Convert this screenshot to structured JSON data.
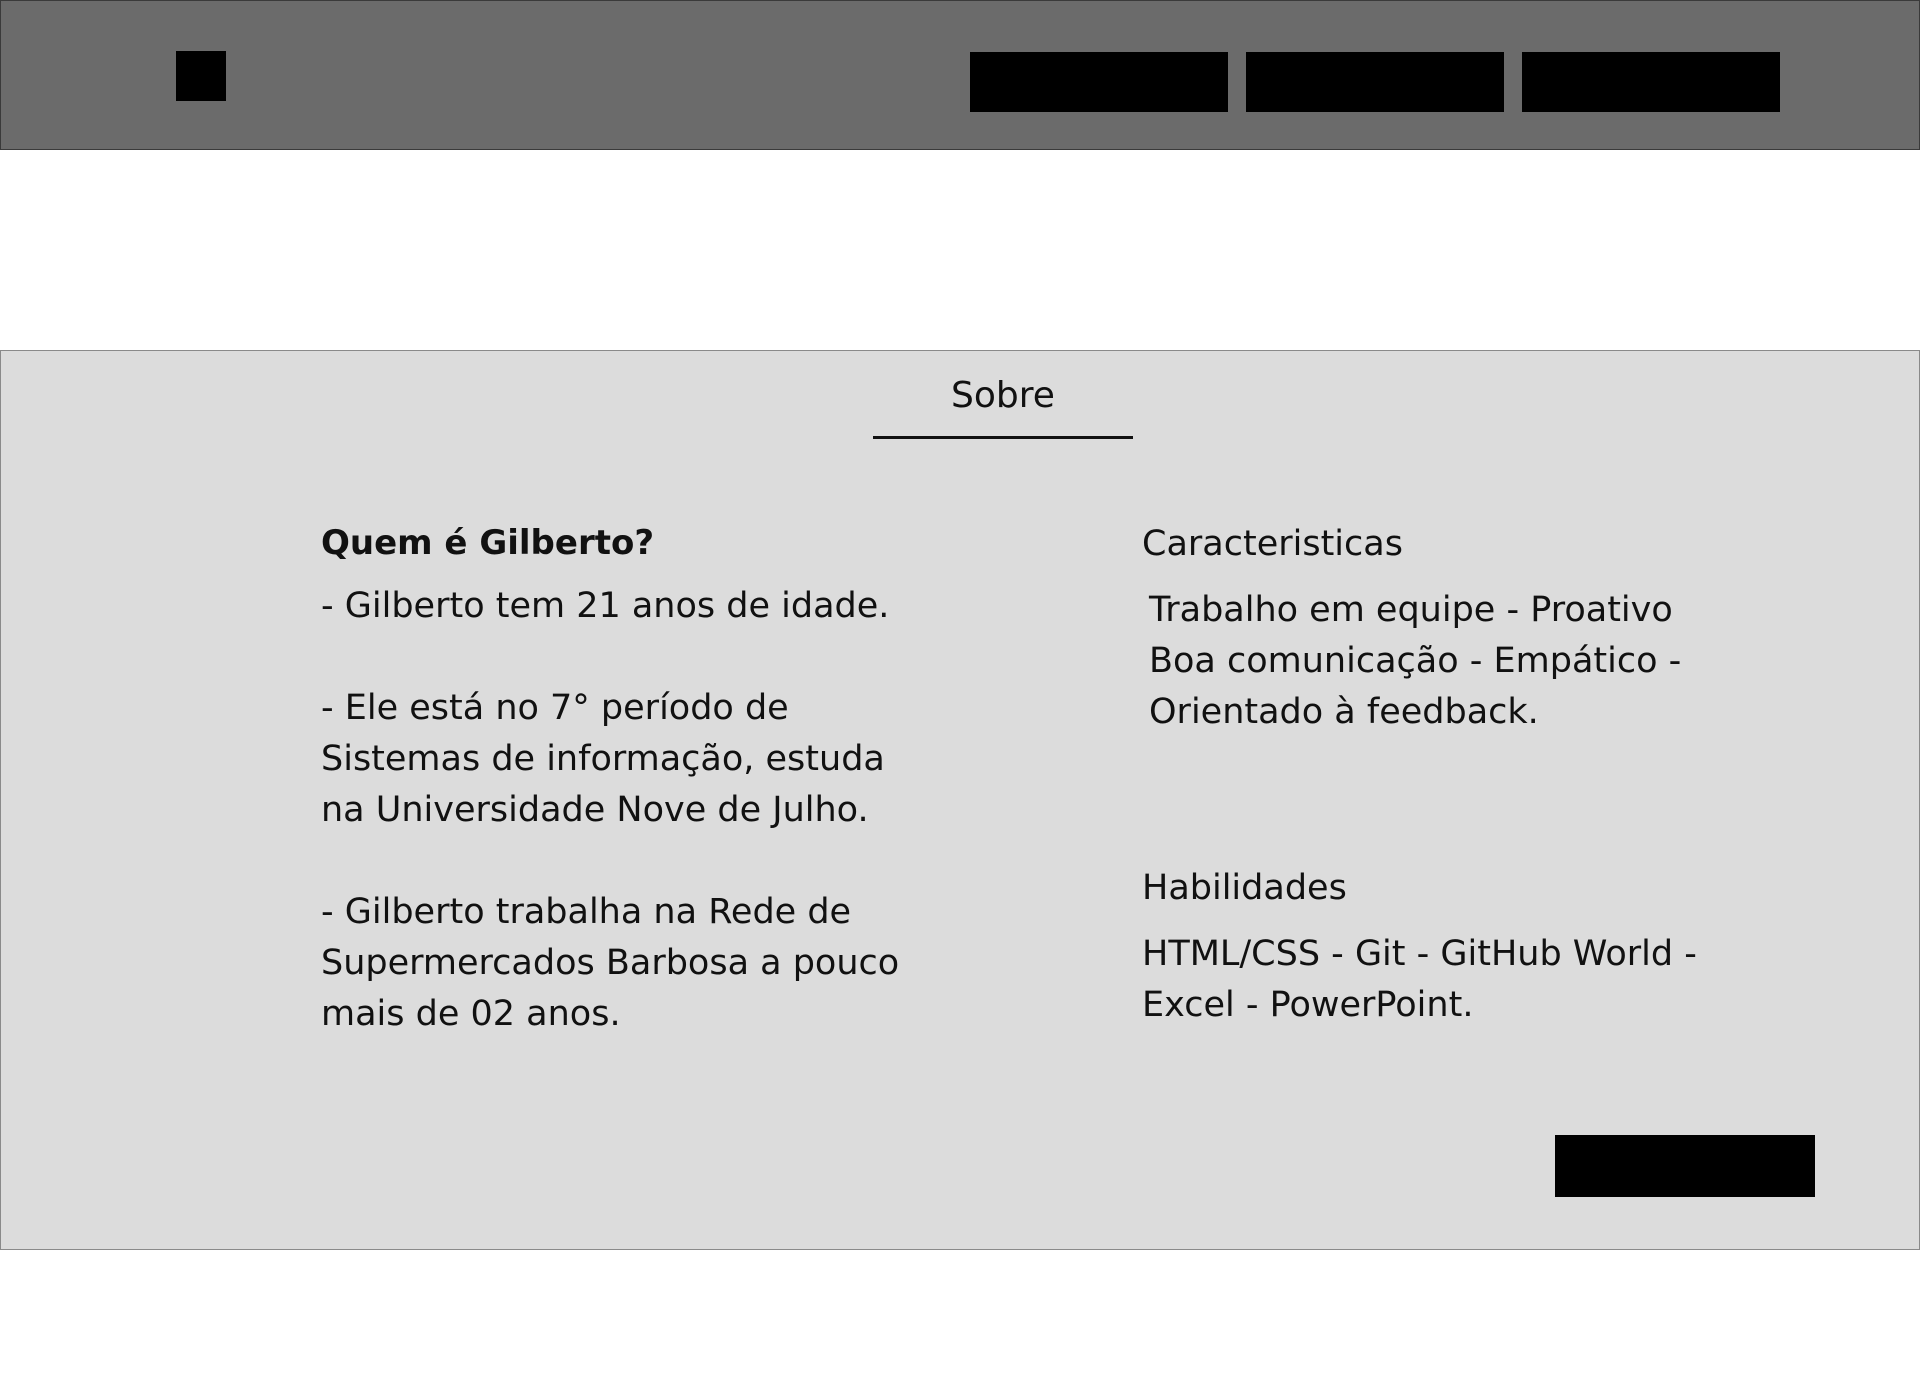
{
  "about": {
    "title": "Sobre",
    "who": {
      "heading": "Quem é Gilberto?",
      "paragraphs": [
        "- Gilberto tem 21 anos de idade.",
        "- Ele está no 7° período de Sistemas de informação, estuda na Universidade Nove de Julho.",
        "- Gilberto trabalha na Rede de Supermercados Barbosa a pouco mais de 02 anos."
      ]
    },
    "traits": {
      "heading": "Caracteristicas",
      "text": "Trabalho em equipe - Proativo Boa comunicação - Empático - Orientado à feedback."
    },
    "skills": {
      "heading": "Habilidades",
      "text": "HTML/CSS - Git - GitHub World - Excel - PowerPoint."
    }
  }
}
